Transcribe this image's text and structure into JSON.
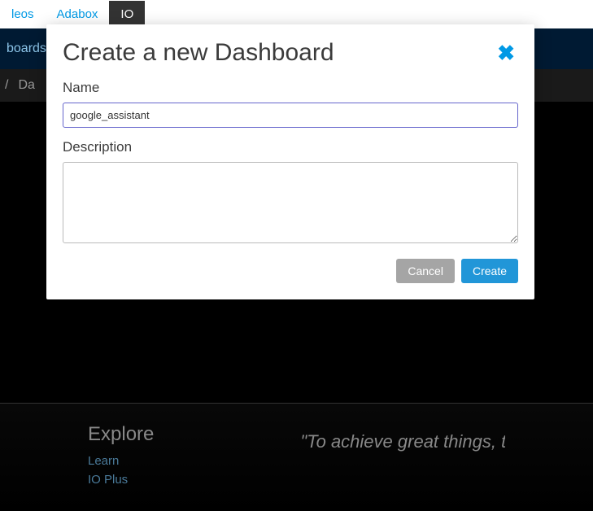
{
  "topNav": {
    "items": [
      {
        "label": "leos"
      },
      {
        "label": "Adabox"
      },
      {
        "label": "IO"
      }
    ]
  },
  "secondaryNav": {
    "itemVisible": "boards"
  },
  "breadcrumb": {
    "separator": "/",
    "itemVisible": "Da"
  },
  "modal": {
    "title": "Create a new Dashboard",
    "nameLabel": "Name",
    "nameValue": "google_assistant",
    "descriptionLabel": "Description",
    "descriptionValue": "",
    "cancelLabel": "Cancel",
    "createLabel": "Create"
  },
  "footer": {
    "exploreHeading": "Explore",
    "links": {
      "learn": "Learn",
      "ioplus": "IO Plus"
    },
    "quote": "\"To achieve great things, two things are needed: a plan and not quite enough"
  }
}
